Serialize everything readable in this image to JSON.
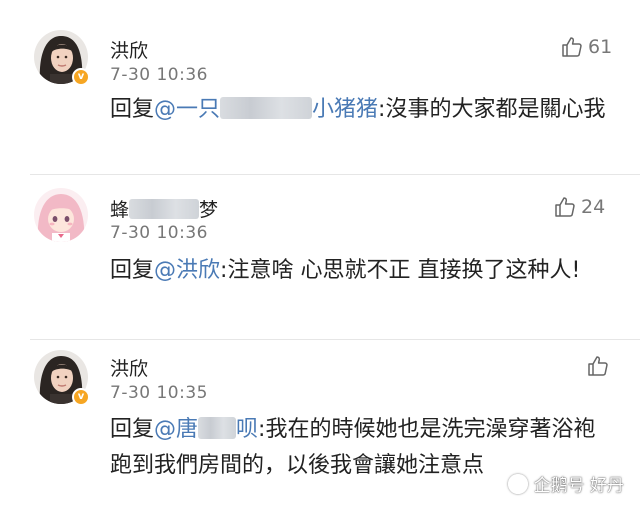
{
  "comments": [
    {
      "author": "洪欣",
      "avatar": "woman-portrait-avatar",
      "verified": true,
      "time": "7-30 10:36",
      "likes": "61",
      "reply_prefix": "回复",
      "mention_start": "@一只",
      "mention_end": "小猪猪",
      "separator": ":",
      "text": "沒事的大家都是關心我"
    },
    {
      "author_start": "蜂",
      "author_end": "梦",
      "avatar": "anime-girl-avatar",
      "verified": false,
      "time": "7-30 10:36",
      "likes": "24",
      "reply_prefix": "回复",
      "mention": "@洪欣",
      "separator": ":",
      "text": "注意啥 心思就不正 直接换了这种人!"
    },
    {
      "author": "洪欣",
      "avatar": "woman-portrait-avatar",
      "verified": true,
      "time": "7-30 10:35",
      "likes": "",
      "reply_prefix": "回复",
      "mention_start": "@唐",
      "mention_end": "呗",
      "separator": ":",
      "text": "我在的時候她也是洗完澡穿著浴袍跑到我們房間的，以後我會讓她注意点"
    }
  ],
  "watermark": {
    "text": "企鹅号 好丹"
  },
  "colors": {
    "mention": "#4a7ab5",
    "verified_badge": "#f6a623",
    "meta_text": "#777777"
  },
  "icons": {
    "like": "thumbs-up-icon",
    "verified": "verified-badge-icon",
    "watermark": "penguin-logo-icon"
  }
}
